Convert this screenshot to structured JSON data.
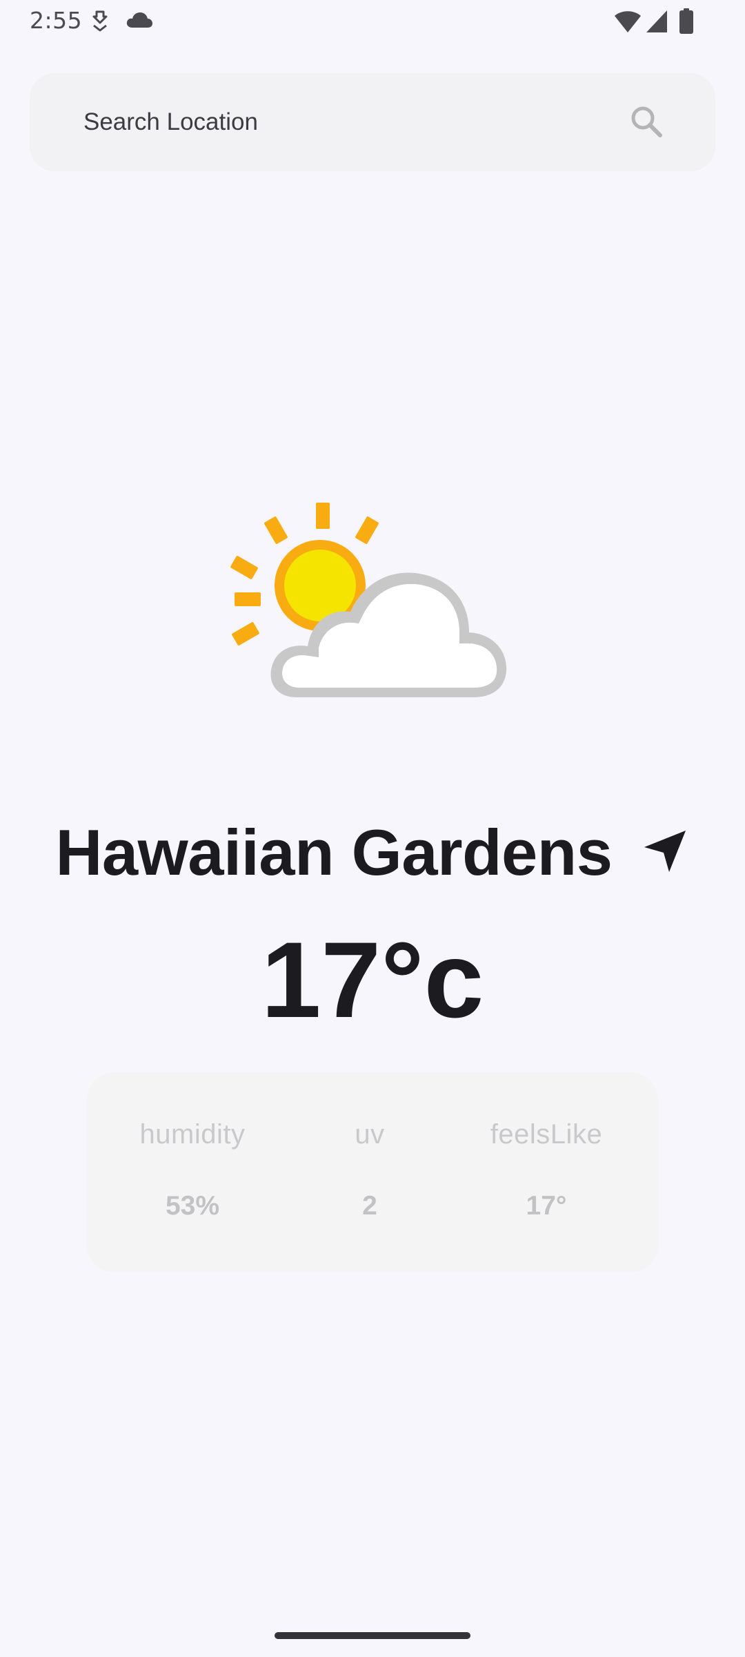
{
  "status_bar": {
    "time": "2:55",
    "icons": [
      "download-indicator-icon",
      "cloud-icon",
      "wifi-icon",
      "cell-signal-icon",
      "battery-icon"
    ]
  },
  "search": {
    "placeholder": "Search Location",
    "value": "",
    "icon": "search-icon"
  },
  "weather": {
    "condition_icon": "partly-cloudy-icon",
    "city": "Hawaiian Gardens",
    "location_icon": "navigation-arrow-icon",
    "temperature": "17°c"
  },
  "details": [
    {
      "label": "humidity",
      "value": "53%"
    },
    {
      "label": "uv",
      "value": "2"
    },
    {
      "label": "feelsLike",
      "value": "17°"
    }
  ],
  "colors": {
    "background": "#f7f6fd",
    "search_bg": "#f2f2f5",
    "card_bg": "#f4f4f4",
    "text_primary": "#1c1b20",
    "text_muted": "#c9c9cc",
    "sun_yellow": "#f5e400",
    "sun_orange": "#f8ac12",
    "cloud_outline": "#c8c8c8"
  }
}
